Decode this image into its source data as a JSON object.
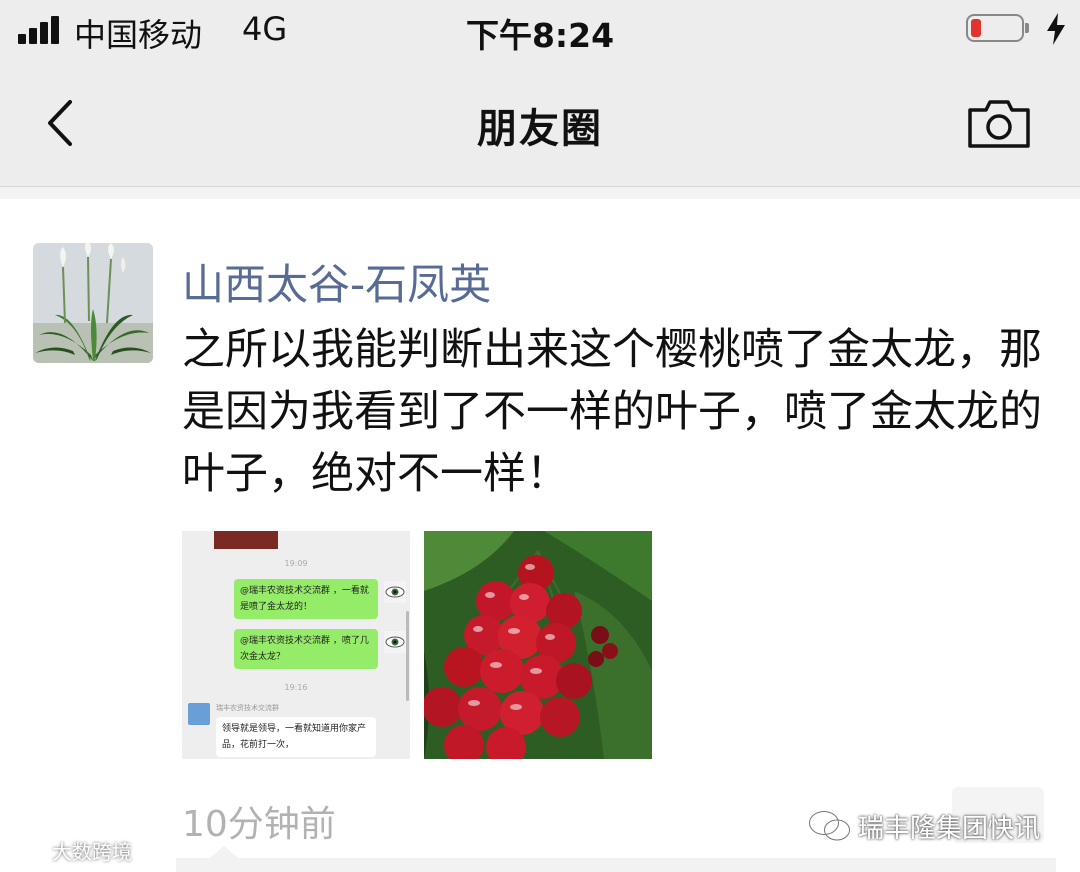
{
  "status_bar": {
    "carrier": "中国移动",
    "network": "4G",
    "time": "下午8:24",
    "battery_color": "#e0342f"
  },
  "nav": {
    "title": "朋友圈",
    "back_icon": "chevron-left-icon",
    "camera_icon": "camera-icon"
  },
  "post": {
    "author": "山西太谷-石凤英",
    "text": "之所以我能判断出来这个樱桃喷了金太龙，那是因为我看到了不一样的叶子，喷了金太龙的叶子，绝对不一样！",
    "timestamp": "10分钟前",
    "name_color": "#576b95",
    "photo1": {
      "time1": "19:09",
      "bubble1": "@瑞丰农资技术交流群 ，一看就是喷了金太龙的！",
      "bubble2": "@瑞丰农资技术交流群 ，喷了几次金太龙？",
      "time2": "19:16",
      "sender": "瑞丰农资技术交流群",
      "reply": "领导就是领导，一看就知道用你家产品，花前打一次，"
    }
  },
  "watermarks": {
    "right": "瑞丰隆集团快讯",
    "left": "大数跨境"
  }
}
